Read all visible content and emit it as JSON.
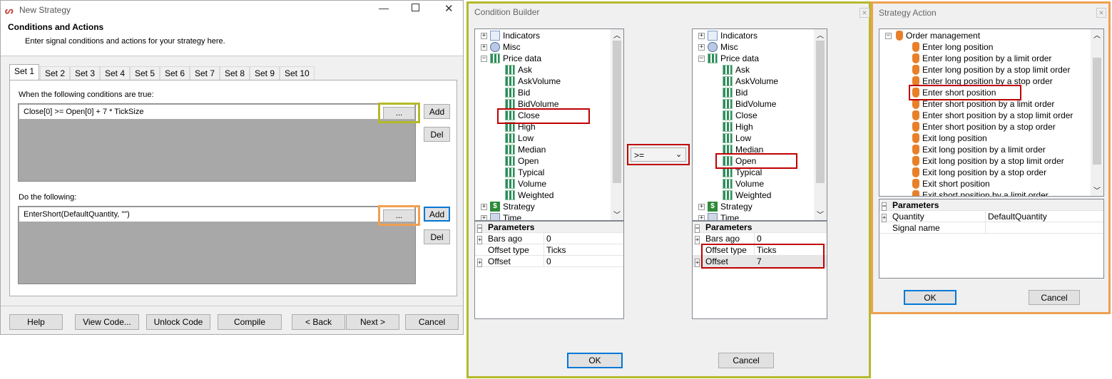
{
  "strategy": {
    "title": "New Strategy",
    "heading": "Conditions and Actions",
    "subheading": "Enter signal conditions and actions for your strategy here.",
    "tabs": [
      "Set 1",
      "Set 2",
      "Set 3",
      "Set 4",
      "Set 5",
      "Set 6",
      "Set 7",
      "Set 8",
      "Set 9",
      "Set 10"
    ],
    "conditions_label": "When the following conditions are true:",
    "condition_value": "Close[0] >= Open[0] + 7 * TickSize",
    "actions_label": "Do the following:",
    "action_value": "EnterShort(DefaultQuantity, \"\")",
    "ellipsis": "...",
    "add": "Add",
    "del": "Del",
    "buttons": {
      "help": "Help",
      "view_code": "View Code...",
      "unlock": "Unlock Code",
      "compile": "Compile",
      "back": "< Back",
      "next": "Next >",
      "cancel": "Cancel"
    }
  },
  "condition_builder": {
    "title": "Condition Builder",
    "left_tree": [
      "Indicators",
      "Misc",
      "Price data",
      "Ask",
      "AskVolume",
      "Bid",
      "BidVolume",
      "Close",
      "High",
      "Low",
      "Median",
      "Open",
      "Typical",
      "Volume",
      "Weighted",
      "Strategy",
      "Time"
    ],
    "right_tree": [
      "Indicators",
      "Misc",
      "Price data",
      "Ask",
      "AskVolume",
      "Bid",
      "BidVolume",
      "Close",
      "High",
      "Low",
      "Median",
      "Open",
      "Typical",
      "Volume",
      "Weighted",
      "Strategy",
      "Time"
    ],
    "operator": ">=",
    "params_header": "Parameters",
    "left_params": [
      [
        "Bars ago",
        "0"
      ],
      [
        "Offset type",
        "Ticks"
      ],
      [
        "Offset",
        "0"
      ]
    ],
    "right_params": [
      [
        "Bars ago",
        "0"
      ],
      [
        "Offset type",
        "Ticks"
      ],
      [
        "Offset",
        "7"
      ]
    ],
    "ok": "OK",
    "cancel": "Cancel"
  },
  "strategy_action": {
    "title": "Strategy Action",
    "root": "Order management",
    "items": [
      "Enter long position",
      "Enter long position by a limit order",
      "Enter long position by a stop limit order",
      "Enter long position by a stop order",
      "Enter short position",
      "Enter short position by a limit order",
      "Enter short position by a stop limit order",
      "Enter short position by a stop order",
      "Exit long position",
      "Exit long position by a limit order",
      "Exit long position by a stop limit order",
      "Exit long position by a stop order",
      "Exit short position",
      "Exit short position by a limit order"
    ],
    "params_header": "Parameters",
    "params": [
      [
        "Quantity",
        "DefaultQuantity"
      ],
      [
        "Signal name",
        ""
      ]
    ],
    "ok": "OK",
    "cancel": "Cancel"
  },
  "colors": {
    "highlight_yellow": "#b5b92a",
    "highlight_orange": "#f0a050",
    "highlight_red": "#c00000",
    "focus_blue": "#0078d7"
  }
}
